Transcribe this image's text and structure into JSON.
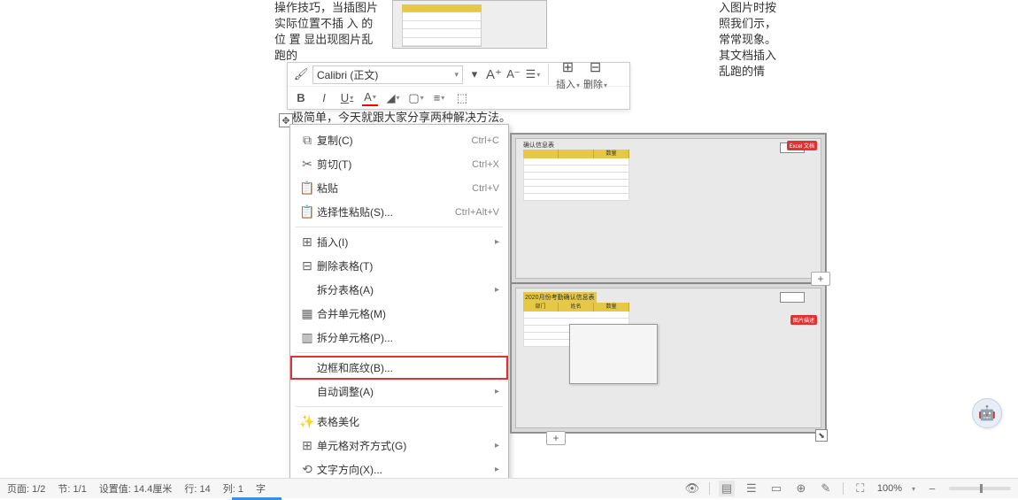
{
  "doc_text_left": "操作技巧，当插图片实际位置不插 入 的 位 置 显出现图片乱跑的",
  "doc_text_right": "入图片时按照我们示，常常现象。其文档插入乱跑的情",
  "behind_text": "极简单，今天就跟大家分享两种解决方法。",
  "mini_toolbar": {
    "font_name": "Calibri (正文)",
    "insert_label": "插入",
    "delete_label": "删除"
  },
  "menu": {
    "copy": "复制(C)",
    "copy_sc": "Ctrl+C",
    "cut": "剪切(T)",
    "cut_sc": "Ctrl+X",
    "paste": "粘贴",
    "paste_sc": "Ctrl+V",
    "paste_special": "选择性粘贴(S)...",
    "paste_special_sc": "Ctrl+Alt+V",
    "insert": "插入(I)",
    "delete_table": "删除表格(T)",
    "split_table": "拆分表格(A)",
    "merge_cells": "合并单元格(M)",
    "split_cells": "拆分单元格(P)...",
    "borders": "边框和底纹(B)...",
    "autofit": "自动调整(A)",
    "table_beautify": "表格美化",
    "cell_align": "单元格对齐方式(G)",
    "text_direction": "文字方向(X)..."
  },
  "statusbar": {
    "page": "页面: 1/2",
    "section": "节: 1/1",
    "setval": "设置值: 14.4厘米",
    "row": "行: 14",
    "col": "列: 1",
    "word": "字",
    "zoom": "100%"
  }
}
